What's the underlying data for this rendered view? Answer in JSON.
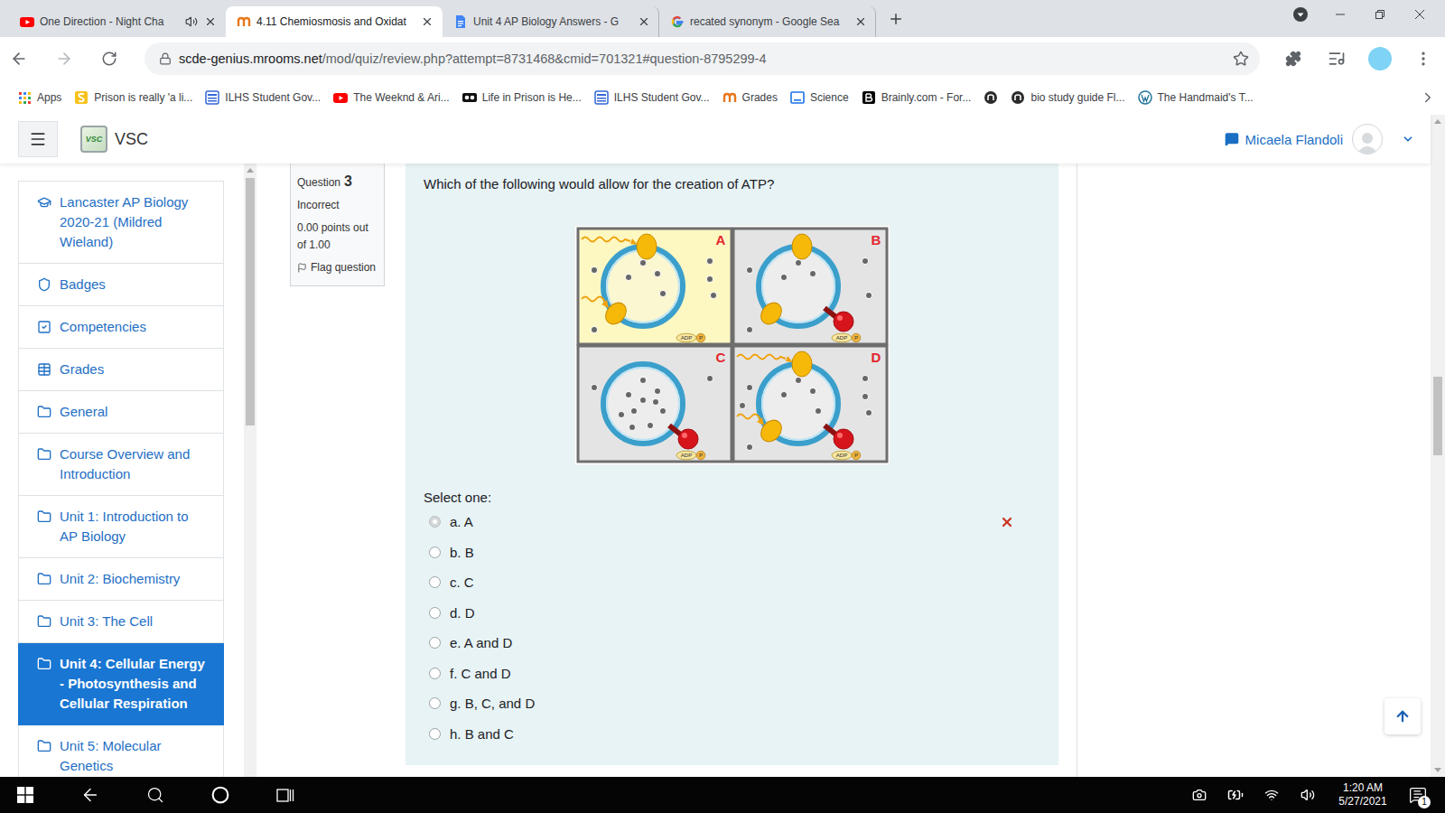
{
  "browser": {
    "tabs": [
      {
        "title": "One Direction - Night Cha",
        "icon": "youtube",
        "audio": true,
        "selected": false
      },
      {
        "title": "4.11 Chemiosmosis and Oxidat",
        "icon": "mrooms",
        "audio": false,
        "selected": true
      },
      {
        "title": "Unit 4 AP Biology Answers - G",
        "icon": "docs",
        "audio": false,
        "selected": false
      },
      {
        "title": "recated synonym - Google Sea",
        "icon": "google",
        "audio": false,
        "selected": false
      }
    ],
    "url": {
      "host": "scde-genius.mrooms.net",
      "path": "/mod/quiz/review.php?attempt=8731468&cmid=701321#question-8795299-4"
    },
    "bookmarked": false,
    "bookmarks": [
      {
        "label": "Apps",
        "kind": "apps"
      },
      {
        "label": "Prison is really 'a li...",
        "kind": "s-yellow"
      },
      {
        "label": "ILHS Student Gov...",
        "kind": "forms"
      },
      {
        "label": "The Weeknd & Ari...",
        "kind": "youtube"
      },
      {
        "label": "Life in Prison is He...",
        "kind": "film"
      },
      {
        "label": "ILHS Student Gov...",
        "kind": "forms"
      },
      {
        "label": "Grades",
        "kind": "mrooms"
      },
      {
        "label": "Science",
        "kind": "classroom"
      },
      {
        "label": "Brainly.com - For...",
        "kind": "brainly"
      },
      {
        "kind": "dark-circle"
      },
      {
        "label": "bio study guide Fl...",
        "kind": "dark-circle"
      },
      {
        "label": "The Handmaid's T...",
        "kind": "wordpress"
      }
    ]
  },
  "site": {
    "logo_text": "VSC",
    "name": "VSC",
    "user": "Micaela Flandoli"
  },
  "sidebar": {
    "items": [
      {
        "label": "Lancaster AP Biology 2020-21 (Mildred Wieland)",
        "icon": "course",
        "selected": false
      },
      {
        "label": "Badges",
        "icon": "badges",
        "selected": false
      },
      {
        "label": "Competencies",
        "icon": "competencies",
        "selected": false
      },
      {
        "label": "Grades",
        "icon": "grades",
        "selected": false
      },
      {
        "label": "General",
        "icon": "section",
        "selected": false
      },
      {
        "label": "Course Overview and Introduction",
        "icon": "section",
        "selected": false
      },
      {
        "label": "Unit 1: Introduction to AP Biology",
        "icon": "section",
        "selected": false
      },
      {
        "label": "Unit 2: Biochemistry",
        "icon": "section",
        "selected": false
      },
      {
        "label": "Unit 3: The Cell",
        "icon": "section",
        "selected": false
      },
      {
        "label": "Unit 4: Cellular Energy - Photosynthesis and Cellular Respiration",
        "icon": "section",
        "selected": true
      },
      {
        "label": "Unit 5: Molecular Genetics",
        "icon": "section",
        "selected": false
      }
    ]
  },
  "question": {
    "label": "Question",
    "number": "3",
    "status": "Incorrect",
    "points": "0.00 points out of 1.00",
    "flag": "Flag question",
    "prompt": "Which of the following would allow for the creation of ATP?",
    "diagram": {
      "panels": [
        {
          "label": "A",
          "highlighted": true,
          "light": true,
          "photosystems": true,
          "synthase": false,
          "protons_inside": 4,
          "protons_outside": 5,
          "adp": "ADP",
          "pi": "P"
        },
        {
          "label": "B",
          "highlighted": false,
          "light": false,
          "photosystems": true,
          "synthase": true,
          "protons_inside": 3,
          "protons_outside": 4,
          "adp": "ADP",
          "pi": "P"
        },
        {
          "label": "C",
          "highlighted": false,
          "light": false,
          "photosystems": false,
          "synthase": true,
          "protons_inside": 10,
          "protons_outside": 2,
          "adp": "ADP",
          "pi": "P"
        },
        {
          "label": "D",
          "highlighted": false,
          "light": true,
          "photosystems": true,
          "synthase": true,
          "protons_inside": 4,
          "protons_outside": 6,
          "adp": "ADP",
          "pi": "P"
        }
      ]
    },
    "select_label": "Select one:",
    "options": [
      {
        "label": "a. A",
        "selected": true,
        "incorrect": true
      },
      {
        "label": "b. B",
        "selected": false,
        "incorrect": false
      },
      {
        "label": "c. C",
        "selected": false,
        "incorrect": false
      },
      {
        "label": "d. D",
        "selected": false,
        "incorrect": false
      },
      {
        "label": "e. A and D",
        "selected": false,
        "incorrect": false
      },
      {
        "label": "f. C and D",
        "selected": false,
        "incorrect": false
      },
      {
        "label": "g. B, C, and D",
        "selected": false,
        "incorrect": false
      },
      {
        "label": "h. B and C",
        "selected": false,
        "incorrect": false
      }
    ]
  },
  "taskbar": {
    "time": "1:20 AM",
    "date": "5/27/2021",
    "notifications": "1"
  }
}
